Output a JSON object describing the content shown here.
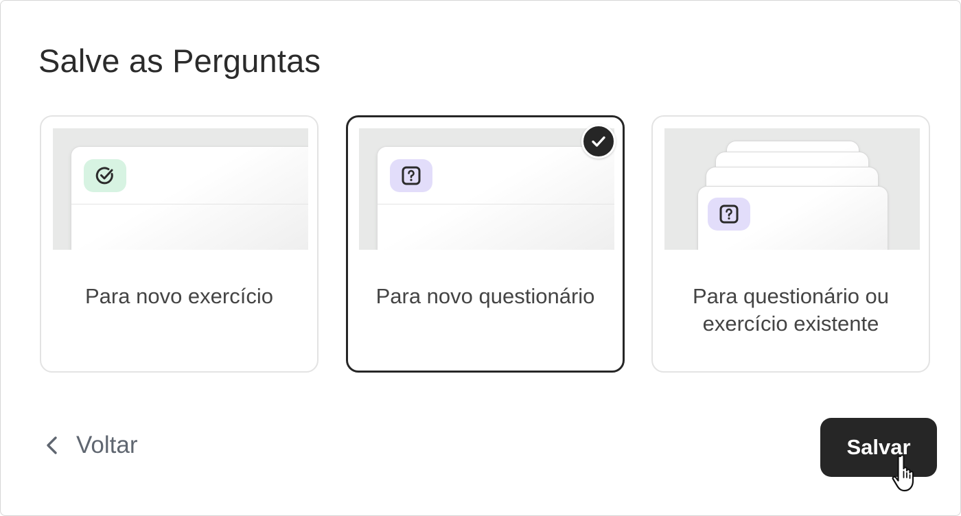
{
  "dialog": {
    "title": "Salve as Perguntas"
  },
  "options": [
    {
      "label": "Para novo exercício",
      "icon": "checkmark-circle-icon",
      "selected": false
    },
    {
      "label": "Para novo questionário",
      "icon": "question-square-icon",
      "selected": true
    },
    {
      "label": "Para questionário ou exercício existente",
      "icon": "question-square-icon",
      "selected": false
    }
  ],
  "footer": {
    "back_label": "Voltar",
    "save_label": "Salvar"
  },
  "colors": {
    "accent": "#262626",
    "green_badge": "#d7f3e2",
    "purple_badge": "#e2ddfa"
  }
}
